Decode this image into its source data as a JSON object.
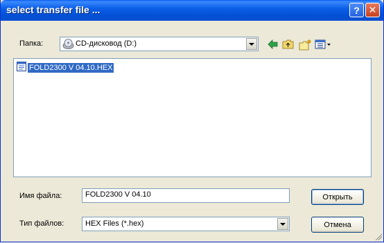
{
  "window": {
    "title": "select transfer file ...",
    "help_label": "?",
    "close_label": "✕"
  },
  "lookin": {
    "label": "Папка:",
    "value": "CD-дисковод (D:)"
  },
  "toolbar": {
    "icons": [
      "back-icon",
      "up-folder-icon",
      "new-folder-icon",
      "view-menu-icon"
    ]
  },
  "files": [
    {
      "name": "FOLD2300 V 04.10.HEX",
      "selected": true
    }
  ],
  "filename": {
    "label": "Имя файла:",
    "value": "FOLD2300 V 04.10"
  },
  "filetype": {
    "label": "Тип файлов:",
    "value": "HEX Files (*.hex)"
  },
  "buttons": {
    "open_label": "Открыть",
    "cancel_label": "Отмена"
  },
  "colors": {
    "titlebar": "#0a5ef6",
    "selection": "#316ac5",
    "dialog_bg": "#ece9d8"
  }
}
